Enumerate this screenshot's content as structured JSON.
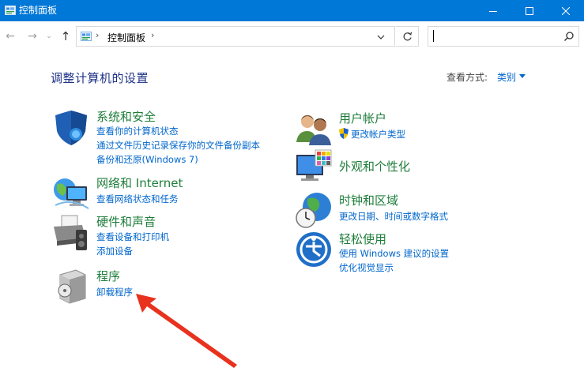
{
  "window": {
    "title": "控制面板"
  },
  "address": {
    "breadcrumb": "控制面板"
  },
  "search": {
    "value": ""
  },
  "main": {
    "heading": "调整计算机的设置",
    "view_by_label": "查看方式:",
    "view_by_value": "类别"
  },
  "categories": {
    "security": {
      "title": "系统和安全",
      "links": [
        "查看你的计算机状态",
        "通过文件历史记录保存你的文件备份副本",
        "备份和还原(Windows 7)"
      ]
    },
    "network": {
      "title": "网络和 Internet",
      "links": [
        "查看网络状态和任务"
      ]
    },
    "hardware": {
      "title": "硬件和声音",
      "links": [
        "查看设备和打印机",
        "添加设备"
      ]
    },
    "programs": {
      "title": "程序",
      "links": [
        "卸载程序"
      ]
    },
    "user_accounts": {
      "title": "用户帐户",
      "links": [
        "更改帐户类型"
      ]
    },
    "appearance": {
      "title": "外观和个性化",
      "links": []
    },
    "clock_region": {
      "title": "时钟和区域",
      "links": [
        "更改日期、时间或数字格式"
      ]
    },
    "ease_of_access": {
      "title": "轻松使用",
      "links": [
        "使用 Windows 建议的设置",
        "优化视觉显示"
      ]
    }
  },
  "colors": {
    "titlebar": "#0078d7",
    "heading": "#1e3287",
    "category_title": "#1e7d3a",
    "link": "#0066cc",
    "annotation_arrow": "#e8321e"
  },
  "icons": {
    "security": "shield-icon",
    "network": "globe-network-icon",
    "hardware": "printer-icon",
    "programs": "software-box-icon",
    "user_accounts": "users-icon",
    "appearance": "monitor-palette-icon",
    "clock_region": "clock-globe-icon",
    "ease_of_access": "ease-of-access-icon"
  }
}
